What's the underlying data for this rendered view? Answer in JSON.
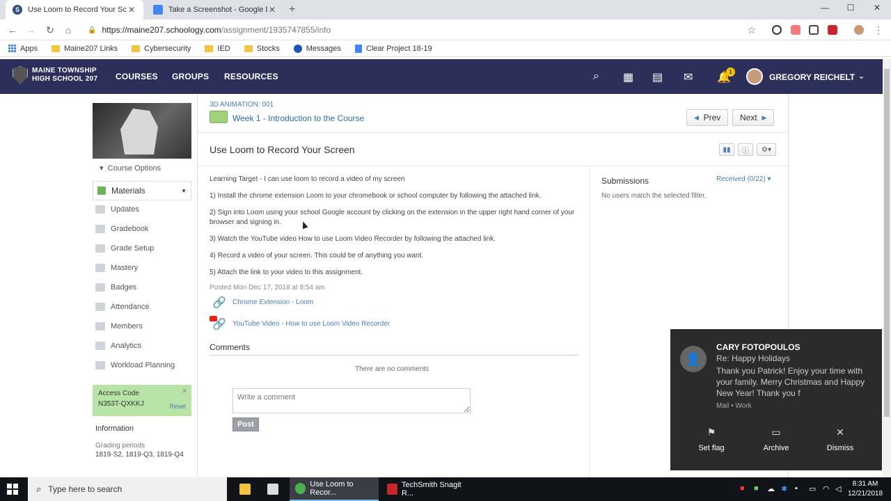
{
  "browser": {
    "tabs": [
      {
        "title": "Use Loom to Record Your Screen",
        "active": true
      },
      {
        "title": "Take a Screenshot - Google Docs",
        "active": false
      }
    ],
    "url_host": "https://maine207.schoology.com",
    "url_path": "/assignment/1935747855/info",
    "bookmarks": [
      "Apps",
      "Maine207 Links",
      "Cybersecurity",
      "IED",
      "Stocks",
      "Messages",
      "Clear Project 18-19"
    ]
  },
  "header": {
    "logo_line1": "MAINE TOWNSHIP",
    "logo_line2": "HIGH SCHOOL 207",
    "nav": [
      "COURSES",
      "GROUPS",
      "RESOURCES"
    ],
    "notif_count": "1",
    "user_name": "GREGORY REICHELT"
  },
  "sidebar": {
    "course_options": "Course Options",
    "materials": "Materials",
    "items": [
      "Updates",
      "Gradebook",
      "Grade Setup",
      "Mastery",
      "Badges",
      "Attendance",
      "Members",
      "Analytics",
      "Workload Planning"
    ],
    "access_title": "Access Code",
    "access_code": "N353T-QXKKJ",
    "access_reset": "Reset",
    "info_title": "Information",
    "grading_label": "Grading periods",
    "grading_value": "1819-S2, 1819-Q3, 1819-Q4"
  },
  "main": {
    "breadcrumb": "3D ANIMATION: 001",
    "week": "Week 1 - Introduction to the Course",
    "prev": "Prev",
    "next": "Next",
    "title": "Use Loom to Record Your Screen",
    "lines": [
      "Learning Target - I can use loom to record a video of my screen",
      "1) Install the chrome extension Loom to your chromebook or school computer by following the attached link.",
      "2) Sign into Loom using your school Google account by clicking on the extension in the upper right hand corner of your browser and signing in.",
      "3) Watch the YouTube video How to use Loom Video Recorder by following the attached link.",
      "4) Record a video of your screen.  This could be of anything you want.",
      "5) Attach the link to your video to this assignment."
    ],
    "posted": "Posted Mon Dec 17, 2018 at 8:54 am",
    "links": [
      "Chrome Extension - Loom",
      "YouTube Video - How to use Loom Video Recorder"
    ],
    "comments_heading": "Comments",
    "no_comments": "There are no comments",
    "comment_placeholder": "Write a comment",
    "post": "Post"
  },
  "submissions": {
    "title": "Submissions",
    "filter": "Received (0/22)",
    "empty": "No users match the selected filter."
  },
  "toast": {
    "sender": "CARY FOTOPOULOS",
    "subject": "Re: Happy Holidays",
    "message": "Thank you Patrick! Enjoy your time with your family. Merry Christmas and Happy New Year! Thank you f",
    "source": "Mail • Work",
    "actions": [
      "Set flag",
      "Archive",
      "Dismiss"
    ]
  },
  "taskbar": {
    "search_placeholder": "Type here to search",
    "apps": [
      "Use Loom to Recor...",
      "TechSmith Snagit R..."
    ],
    "time": "8:31 AM",
    "date": "12/21/2018"
  },
  "colors": {
    "header_bg": "#2c2f5a",
    "link": "#4a7cb5",
    "access_bg": "#b9e4a8",
    "toast_bg": "#2b2b2b"
  }
}
